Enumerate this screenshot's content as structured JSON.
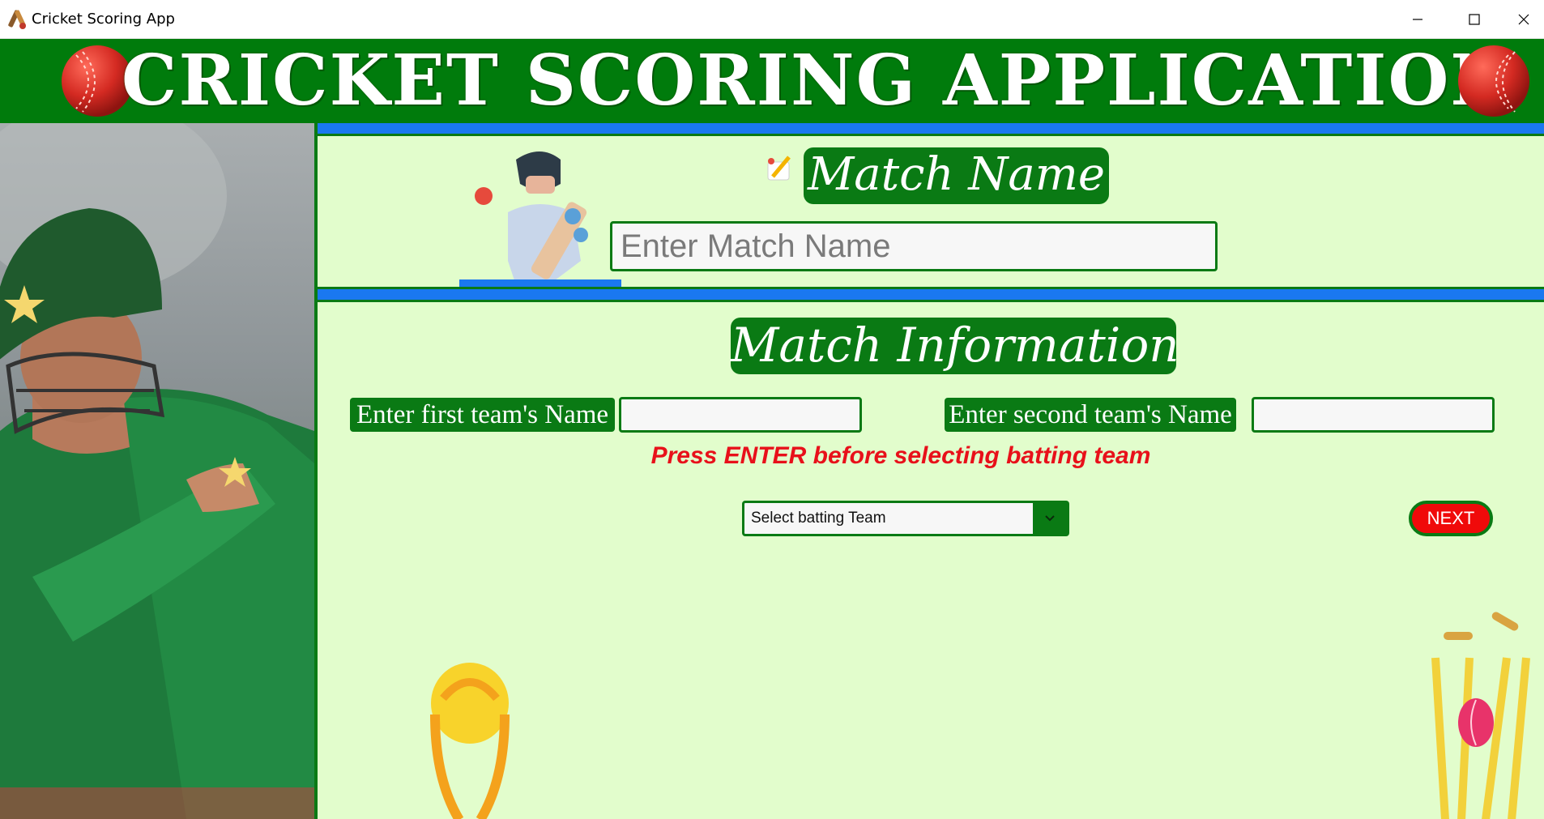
{
  "window": {
    "title": "Cricket Scoring App",
    "icons": [
      "app-icon",
      "minimize-icon",
      "maximize-icon",
      "close-icon"
    ]
  },
  "banner": {
    "title": "CRICKET SCORING APPLICATION",
    "icons": [
      "cricket-ball-icon",
      "cricket-ball-icon"
    ]
  },
  "match_name": {
    "heading": "Match Name",
    "input_placeholder": "Enter Match Name",
    "input_value": "",
    "icons": [
      "pencil-icon",
      "batsman-illustration"
    ]
  },
  "match_info": {
    "heading": "Match Information",
    "first_team_label": "Enter first team's Name",
    "first_team_value": "",
    "second_team_label": "Enter second team's Name",
    "second_team_value": "",
    "hint": "Press ENTER before selecting batting team",
    "batting_team_select": "Select batting Team",
    "next_button": "NEXT",
    "icons": [
      "chevron-down-icon",
      "trophy-illustration",
      "wicket-illustration"
    ]
  },
  "colors": {
    "brand_green": "#0a7a14",
    "background": "#e2fdcc",
    "stripe_blue": "#1a78f0",
    "alert_red": "#e8101a",
    "next_red": "#f00a0a"
  }
}
